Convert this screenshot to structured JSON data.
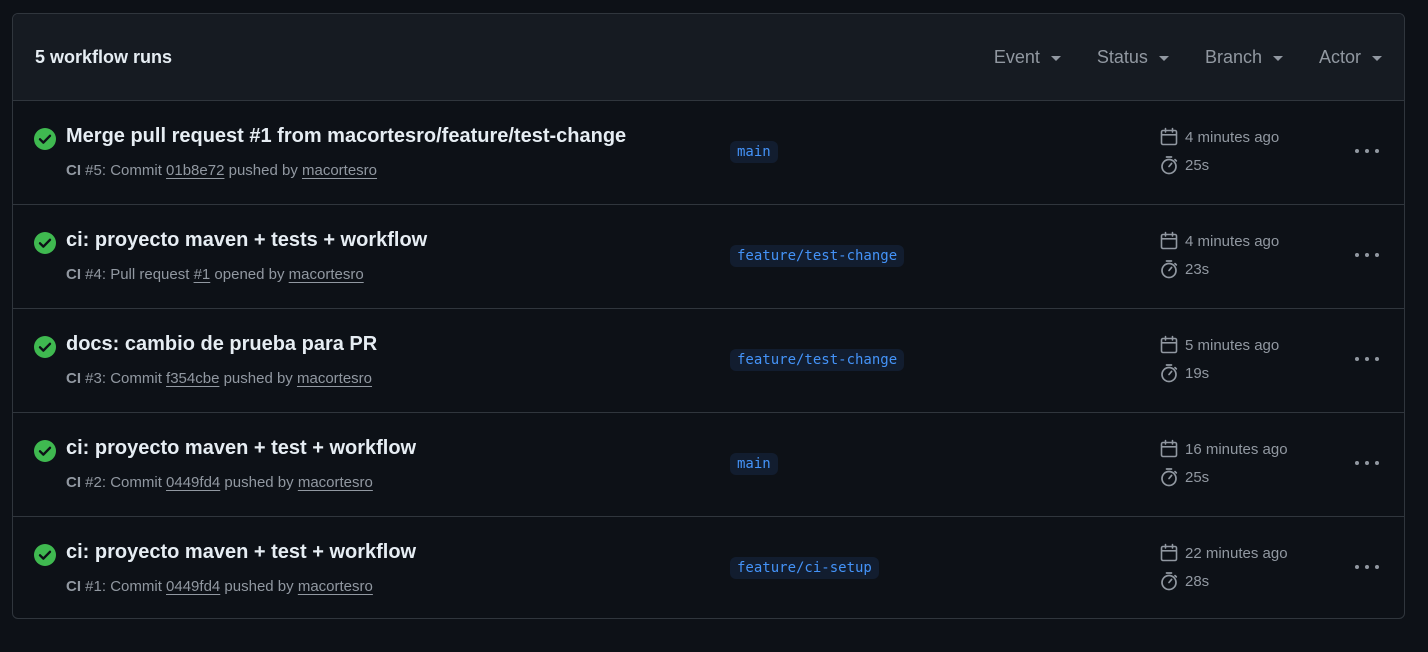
{
  "header": {
    "title": "5 workflow runs",
    "filters": [
      "Event",
      "Status",
      "Branch",
      "Actor"
    ]
  },
  "colors": {
    "success": "#3fb950",
    "link": "#4493f8",
    "muted": "#9198a1"
  },
  "runs": [
    {
      "title": "Merge pull request #1 from macortesro/feature/test-change",
      "workflow": "CI",
      "run_number": "#5",
      "action_prefix": ": Commit ",
      "ref": "01b8e72",
      "action_suffix": " pushed by ",
      "actor": "macortesro",
      "branch": "main",
      "time_ago": "4 minutes ago",
      "duration": "25s",
      "status": "success"
    },
    {
      "title": "ci: proyecto maven + tests + workflow",
      "workflow": "CI",
      "run_number": "#4",
      "action_prefix": ": Pull request ",
      "ref": "#1",
      "action_suffix": " opened by ",
      "actor": "macortesro",
      "branch": "feature/test-change",
      "time_ago": "4 minutes ago",
      "duration": "23s",
      "status": "success"
    },
    {
      "title": "docs: cambio de prueba para PR",
      "workflow": "CI",
      "run_number": "#3",
      "action_prefix": ": Commit ",
      "ref": "f354cbe",
      "action_suffix": " pushed by ",
      "actor": "macortesro",
      "branch": "feature/test-change",
      "time_ago": "5 minutes ago",
      "duration": "19s",
      "status": "success"
    },
    {
      "title": "ci: proyecto maven + test + workflow",
      "workflow": "CI",
      "run_number": "#2",
      "action_prefix": ": Commit ",
      "ref": "0449fd4",
      "action_suffix": " pushed by ",
      "actor": "macortesro",
      "branch": "main",
      "time_ago": "16 minutes ago",
      "duration": "25s",
      "status": "success"
    },
    {
      "title": "ci: proyecto maven + test + workflow",
      "workflow": "CI",
      "run_number": "#1",
      "action_prefix": ": Commit ",
      "ref": "0449fd4",
      "action_suffix": " pushed by ",
      "actor": "macortesro",
      "branch": "feature/ci-setup",
      "time_ago": "22 minutes ago",
      "duration": "28s",
      "status": "success"
    }
  ]
}
